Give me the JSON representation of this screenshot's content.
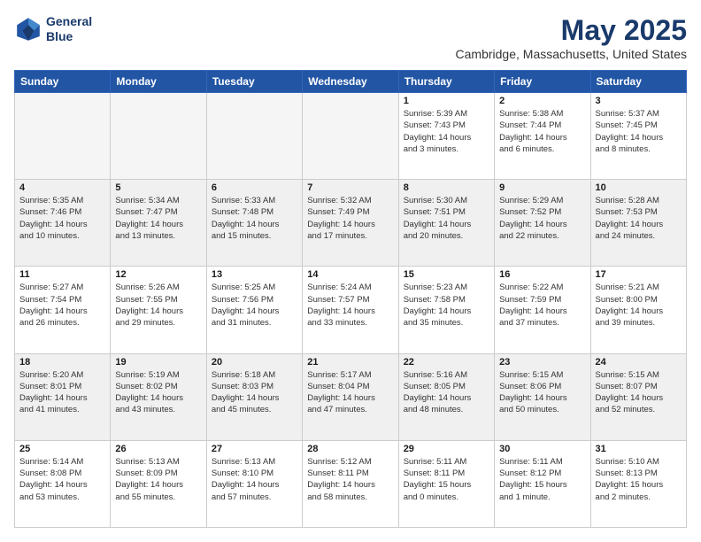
{
  "header": {
    "logo_line1": "General",
    "logo_line2": "Blue",
    "month": "May 2025",
    "location": "Cambridge, Massachusetts, United States"
  },
  "weekdays": [
    "Sunday",
    "Monday",
    "Tuesday",
    "Wednesday",
    "Thursday",
    "Friday",
    "Saturday"
  ],
  "weeks": [
    [
      {
        "day": "",
        "info": "",
        "empty": true
      },
      {
        "day": "",
        "info": "",
        "empty": true
      },
      {
        "day": "",
        "info": "",
        "empty": true
      },
      {
        "day": "",
        "info": "",
        "empty": true
      },
      {
        "day": "1",
        "info": "Sunrise: 5:39 AM\nSunset: 7:43 PM\nDaylight: 14 hours\nand 3 minutes."
      },
      {
        "day": "2",
        "info": "Sunrise: 5:38 AM\nSunset: 7:44 PM\nDaylight: 14 hours\nand 6 minutes."
      },
      {
        "day": "3",
        "info": "Sunrise: 5:37 AM\nSunset: 7:45 PM\nDaylight: 14 hours\nand 8 minutes."
      }
    ],
    [
      {
        "day": "4",
        "info": "Sunrise: 5:35 AM\nSunset: 7:46 PM\nDaylight: 14 hours\nand 10 minutes."
      },
      {
        "day": "5",
        "info": "Sunrise: 5:34 AM\nSunset: 7:47 PM\nDaylight: 14 hours\nand 13 minutes."
      },
      {
        "day": "6",
        "info": "Sunrise: 5:33 AM\nSunset: 7:48 PM\nDaylight: 14 hours\nand 15 minutes."
      },
      {
        "day": "7",
        "info": "Sunrise: 5:32 AM\nSunset: 7:49 PM\nDaylight: 14 hours\nand 17 minutes."
      },
      {
        "day": "8",
        "info": "Sunrise: 5:30 AM\nSunset: 7:51 PM\nDaylight: 14 hours\nand 20 minutes."
      },
      {
        "day": "9",
        "info": "Sunrise: 5:29 AM\nSunset: 7:52 PM\nDaylight: 14 hours\nand 22 minutes."
      },
      {
        "day": "10",
        "info": "Sunrise: 5:28 AM\nSunset: 7:53 PM\nDaylight: 14 hours\nand 24 minutes."
      }
    ],
    [
      {
        "day": "11",
        "info": "Sunrise: 5:27 AM\nSunset: 7:54 PM\nDaylight: 14 hours\nand 26 minutes."
      },
      {
        "day": "12",
        "info": "Sunrise: 5:26 AM\nSunset: 7:55 PM\nDaylight: 14 hours\nand 29 minutes."
      },
      {
        "day": "13",
        "info": "Sunrise: 5:25 AM\nSunset: 7:56 PM\nDaylight: 14 hours\nand 31 minutes."
      },
      {
        "day": "14",
        "info": "Sunrise: 5:24 AM\nSunset: 7:57 PM\nDaylight: 14 hours\nand 33 minutes."
      },
      {
        "day": "15",
        "info": "Sunrise: 5:23 AM\nSunset: 7:58 PM\nDaylight: 14 hours\nand 35 minutes."
      },
      {
        "day": "16",
        "info": "Sunrise: 5:22 AM\nSunset: 7:59 PM\nDaylight: 14 hours\nand 37 minutes."
      },
      {
        "day": "17",
        "info": "Sunrise: 5:21 AM\nSunset: 8:00 PM\nDaylight: 14 hours\nand 39 minutes."
      }
    ],
    [
      {
        "day": "18",
        "info": "Sunrise: 5:20 AM\nSunset: 8:01 PM\nDaylight: 14 hours\nand 41 minutes."
      },
      {
        "day": "19",
        "info": "Sunrise: 5:19 AM\nSunset: 8:02 PM\nDaylight: 14 hours\nand 43 minutes."
      },
      {
        "day": "20",
        "info": "Sunrise: 5:18 AM\nSunset: 8:03 PM\nDaylight: 14 hours\nand 45 minutes."
      },
      {
        "day": "21",
        "info": "Sunrise: 5:17 AM\nSunset: 8:04 PM\nDaylight: 14 hours\nand 47 minutes."
      },
      {
        "day": "22",
        "info": "Sunrise: 5:16 AM\nSunset: 8:05 PM\nDaylight: 14 hours\nand 48 minutes."
      },
      {
        "day": "23",
        "info": "Sunrise: 5:15 AM\nSunset: 8:06 PM\nDaylight: 14 hours\nand 50 minutes."
      },
      {
        "day": "24",
        "info": "Sunrise: 5:15 AM\nSunset: 8:07 PM\nDaylight: 14 hours\nand 52 minutes."
      }
    ],
    [
      {
        "day": "25",
        "info": "Sunrise: 5:14 AM\nSunset: 8:08 PM\nDaylight: 14 hours\nand 53 minutes."
      },
      {
        "day": "26",
        "info": "Sunrise: 5:13 AM\nSunset: 8:09 PM\nDaylight: 14 hours\nand 55 minutes."
      },
      {
        "day": "27",
        "info": "Sunrise: 5:13 AM\nSunset: 8:10 PM\nDaylight: 14 hours\nand 57 minutes."
      },
      {
        "day": "28",
        "info": "Sunrise: 5:12 AM\nSunset: 8:11 PM\nDaylight: 14 hours\nand 58 minutes."
      },
      {
        "day": "29",
        "info": "Sunrise: 5:11 AM\nSunset: 8:11 PM\nDaylight: 15 hours\nand 0 minutes."
      },
      {
        "day": "30",
        "info": "Sunrise: 5:11 AM\nSunset: 8:12 PM\nDaylight: 15 hours\nand 1 minute."
      },
      {
        "day": "31",
        "info": "Sunrise: 5:10 AM\nSunset: 8:13 PM\nDaylight: 15 hours\nand 2 minutes."
      }
    ]
  ]
}
